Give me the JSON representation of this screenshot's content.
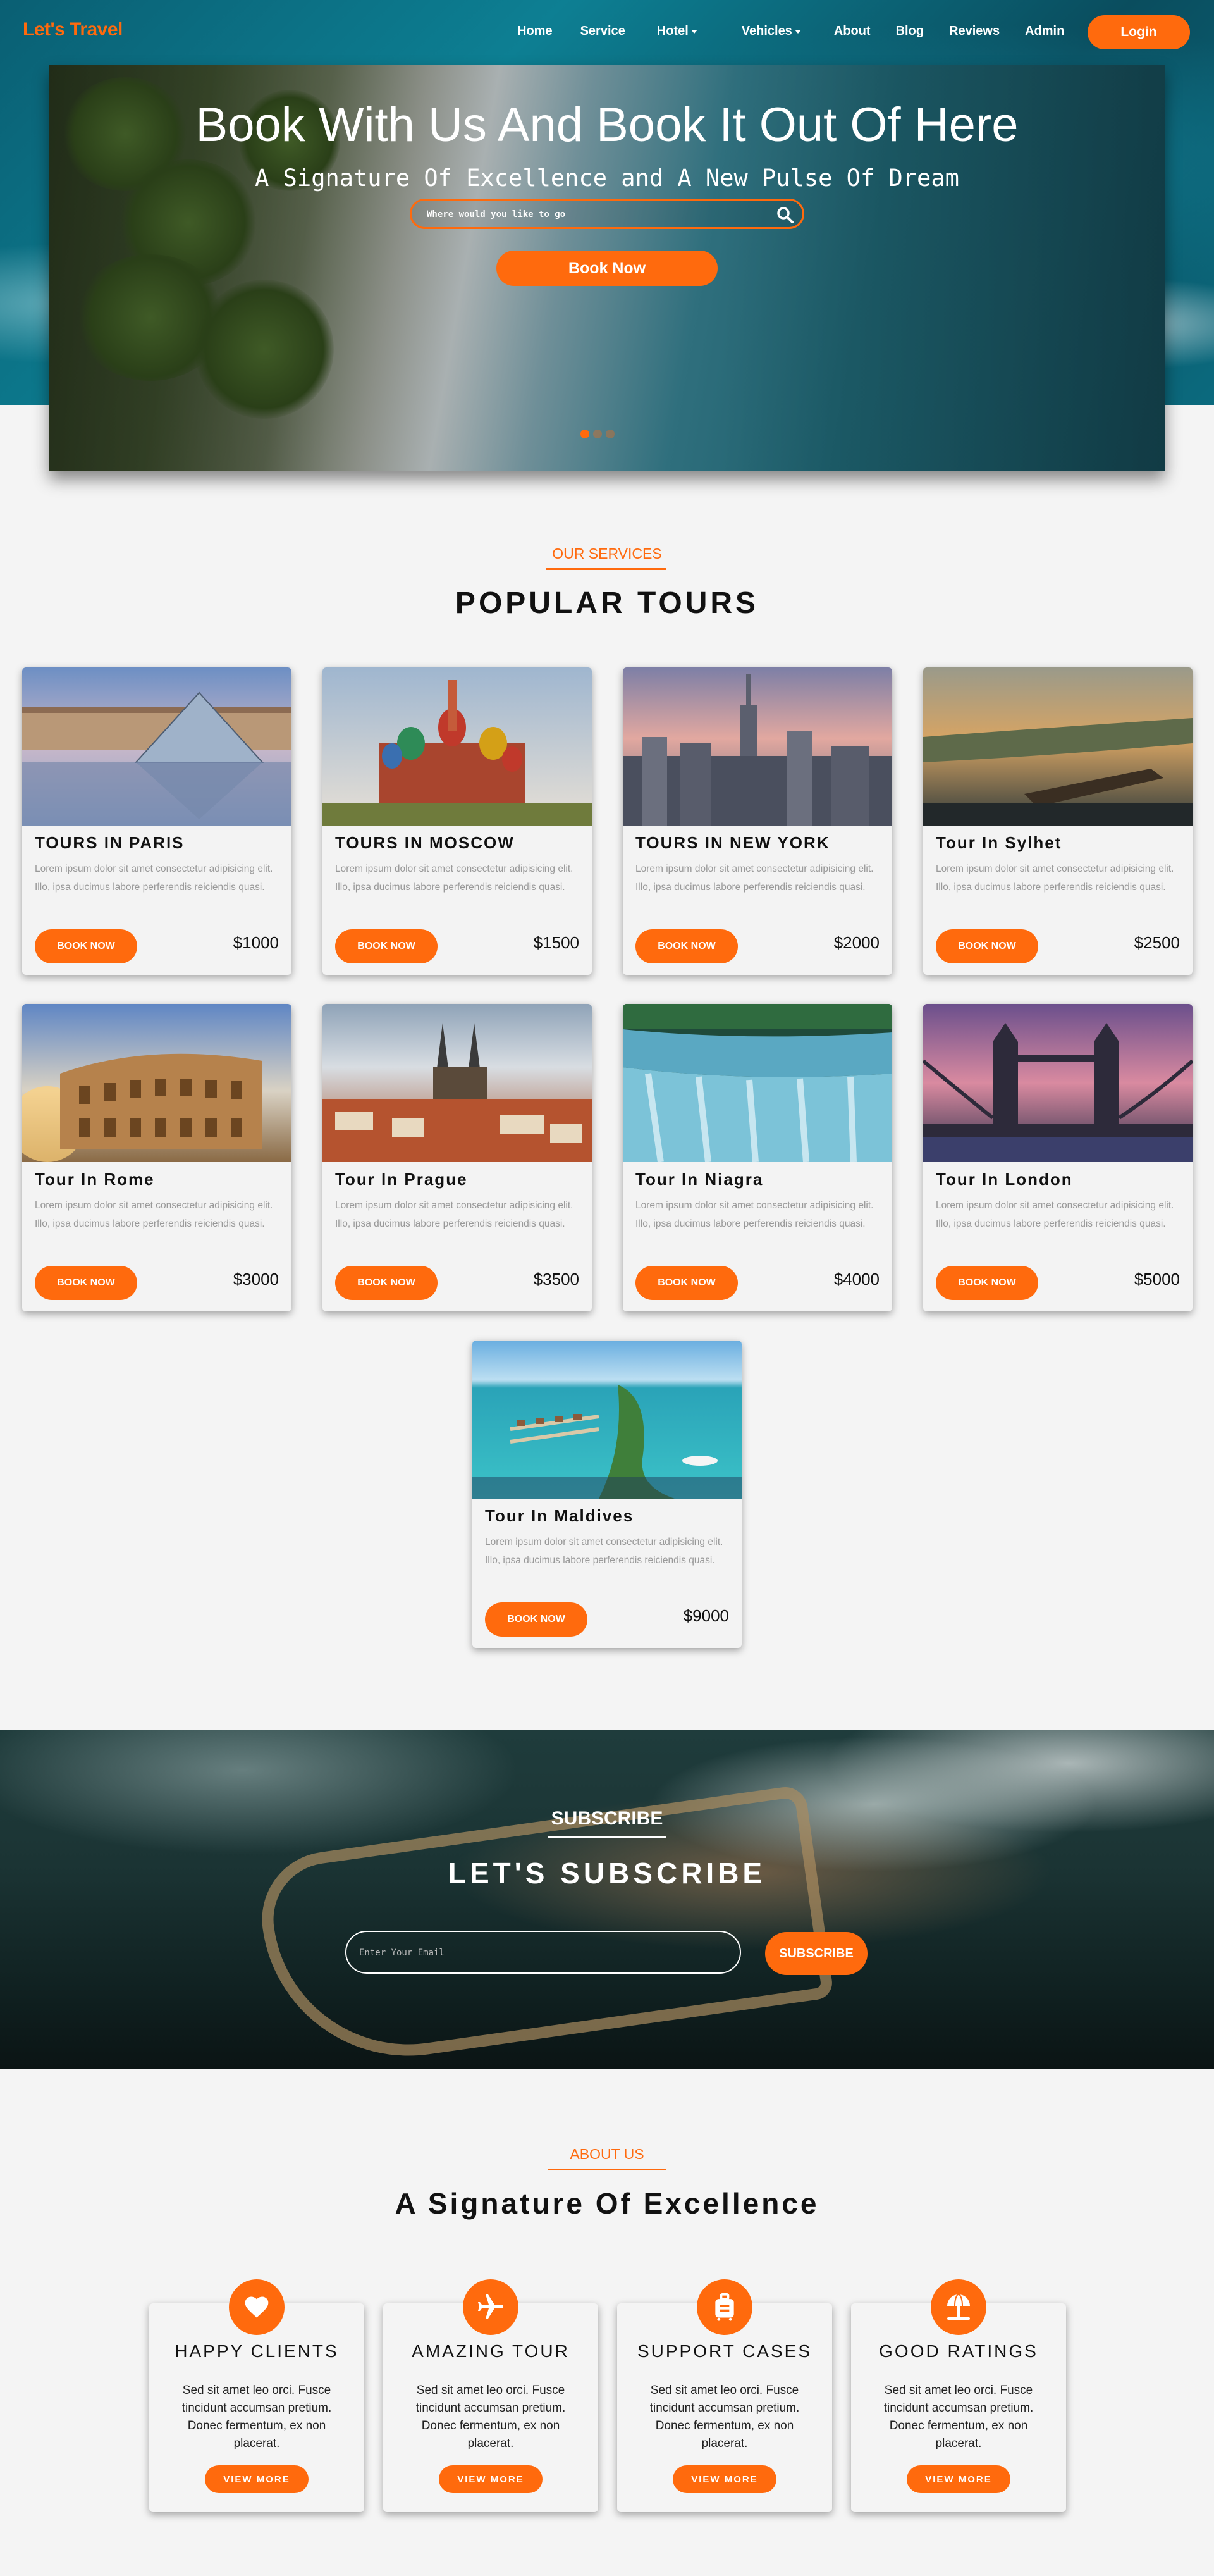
{
  "brand": {
    "name": "Let's Travel",
    "accent": "#ff6a0d"
  },
  "nav": {
    "items": [
      {
        "label": "Home",
        "dropdown": false
      },
      {
        "label": "Service",
        "dropdown": false
      },
      {
        "label": "Hotel",
        "dropdown": true
      },
      {
        "label": "Vehicles",
        "dropdown": true
      },
      {
        "label": "About",
        "dropdown": false
      },
      {
        "label": "Blog",
        "dropdown": false
      },
      {
        "label": "Reviews",
        "dropdown": false
      },
      {
        "label": "Admin",
        "dropdown": false
      }
    ],
    "login_label": "Login"
  },
  "hero": {
    "title": "Book With Us And Book It Out Of Here",
    "subtitle": "A Signature Of Excellence and A New Pulse Of Dream",
    "search_placeholder": "Where would you like to go",
    "search_icon": "search-icon",
    "book_now_label": "Book Now",
    "slides_count": 3,
    "active_slide": 1
  },
  "services": {
    "eyebrow": "OUR SERVICES",
    "title": "POPULAR TOURS",
    "tours": [
      {
        "name": "TOURS IN PARIS",
        "description": "Lorem ipsum dolor sit amet consectetur adipisicing elit. Illo, ipsa ducimus labore perferendis reiciendis quasi.",
        "book_label": "BOOK NOW",
        "price": "$1000",
        "image": "paris"
      },
      {
        "name": "TOURS IN MOSCOW",
        "description": "Lorem ipsum dolor sit amet consectetur adipisicing elit. Illo, ipsa ducimus labore perferendis reiciendis quasi.",
        "book_label": "BOOK NOW",
        "price": "$1500",
        "image": "moscow"
      },
      {
        "name": "TOURS IN NEW YORK",
        "description": "Lorem ipsum dolor sit amet consectetur adipisicing elit. Illo, ipsa ducimus labore perferendis reiciendis quasi.",
        "book_label": "BOOK NOW",
        "price": "$2000",
        "image": "newyork"
      },
      {
        "name": "Tour In Sylhet",
        "description": "Lorem ipsum dolor sit amet consectetur adipisicing elit. Illo, ipsa ducimus labore perferendis reiciendis quasi.",
        "book_label": "BOOK NOW",
        "price": "$2500",
        "image": "sylhet"
      },
      {
        "name": "Tour In Rome",
        "description": "Lorem ipsum dolor sit amet consectetur adipisicing elit. Illo, ipsa ducimus labore perferendis reiciendis quasi.",
        "book_label": "BOOK NOW",
        "price": "$3000",
        "image": "rome"
      },
      {
        "name": "Tour In Prague",
        "description": "Lorem ipsum dolor sit amet consectetur adipisicing elit. Illo, ipsa ducimus labore perferendis reiciendis quasi.",
        "book_label": "BOOK NOW",
        "price": "$3500",
        "image": "prague"
      },
      {
        "name": "Tour In Niagra",
        "description": "Lorem ipsum dolor sit amet consectetur adipisicing elit. Illo, ipsa ducimus labore perferendis reiciendis quasi.",
        "book_label": "BOOK NOW",
        "price": "$4000",
        "image": "niagara"
      },
      {
        "name": "Tour In London",
        "description": "Lorem ipsum dolor sit amet consectetur adipisicing elit. Illo, ipsa ducimus labore perferendis reiciendis quasi.",
        "book_label": "BOOK NOW",
        "price": "$5000",
        "image": "london"
      },
      {
        "name": "Tour In Maldives",
        "description": "Lorem ipsum dolor sit amet consectetur adipisicing elit. Illo, ipsa ducimus labore perferendis reiciendis quasi.",
        "book_label": "BOOK NOW",
        "price": "$9000",
        "image": "maldives"
      }
    ]
  },
  "subscribe": {
    "eyebrow": "SUBSCRIBE",
    "title": "LET'S SUBSCRIBE",
    "email_placeholder": "Enter Your Email",
    "button_label": "SUBSCRIBE"
  },
  "about": {
    "eyebrow": "ABOUT US",
    "title": "A Signature Of Excellence",
    "cards": [
      {
        "icon": "heart-icon",
        "title": "HAPPY CLIENTS",
        "text": "Sed sit amet leo orci. Fusce tincidunt accumsan pretium. Donec fermentum, ex non placerat.",
        "button_label": "VIEW MORE"
      },
      {
        "icon": "airplane-icon",
        "title": "AMAZING TOUR",
        "text": "Sed sit amet leo orci. Fusce tincidunt accumsan pretium. Donec fermentum, ex non placerat.",
        "button_label": "VIEW MORE"
      },
      {
        "icon": "suitcase-icon",
        "title": "SUPPORT CASES",
        "text": "Sed sit amet leo orci. Fusce tincidunt accumsan pretium. Donec fermentum, ex non placerat.",
        "button_label": "VIEW MORE"
      },
      {
        "icon": "beach-umbrella-icon",
        "title": "GOOD RATINGS",
        "text": "Sed sit amet leo orci. Fusce tincidunt accumsan pretium. Donec fermentum, ex non placerat.",
        "button_label": "VIEW MORE"
      }
    ]
  }
}
